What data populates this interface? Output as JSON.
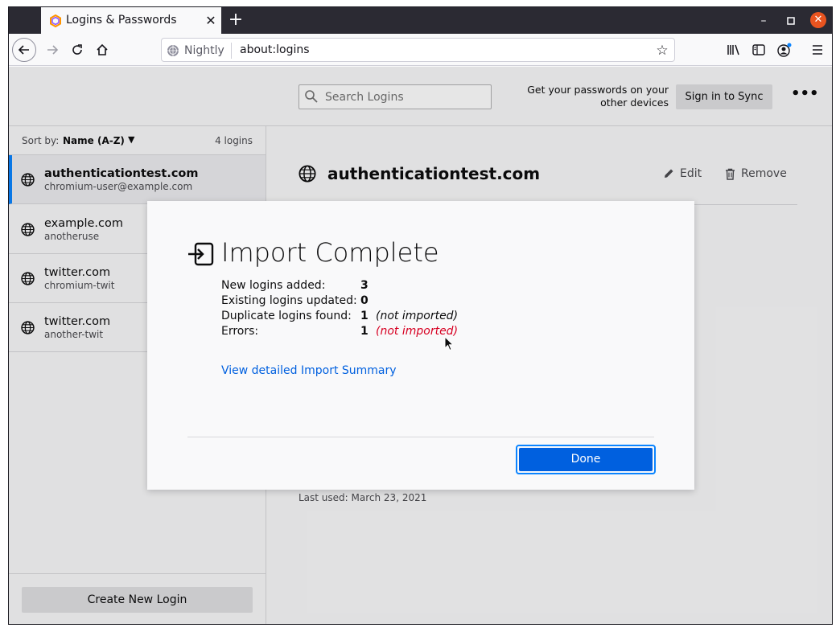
{
  "browser": {
    "tab_title": "Logins & Passwords",
    "identity_label": "Nightly",
    "url": "about:logins"
  },
  "header": {
    "search_placeholder": "Search Logins",
    "sync_text": "Get your passwords on your other devices",
    "sync_button": "Sign in to Sync"
  },
  "sidebar": {
    "sort_label": "Sort by:",
    "sort_value": "Name (A-Z)",
    "login_count": "4 logins",
    "items": [
      {
        "title": "authenticationtest.com",
        "subtitle": "chromium-user@example.com"
      },
      {
        "title": "example.com",
        "subtitle": "anotheruse"
      },
      {
        "title": "twitter.com",
        "subtitle": "chromium-twit"
      },
      {
        "title": "twitter.com",
        "subtitle": "another-twit"
      }
    ],
    "create_button": "Create New Login"
  },
  "detail": {
    "title": "authenticationtest.com",
    "edit_label": "Edit",
    "remove_label": "Remove",
    "last_used": "Last used: March 23, 2021"
  },
  "dialog": {
    "title": "Import Complete",
    "stats": [
      {
        "label": "New logins added:",
        "value": "3",
        "note": ""
      },
      {
        "label": "Existing logins updated:",
        "value": "0",
        "note": ""
      },
      {
        "label": "Duplicate logins found:",
        "value": "1",
        "note": "(not imported)"
      },
      {
        "label": "Errors:",
        "value": "1",
        "note": "(not imported)"
      }
    ],
    "summary_link": "View detailed Import Summary",
    "done_button": "Done"
  },
  "colors": {
    "accent": "#0060df",
    "error": "#d70022",
    "focus_ring": "#0a84ff",
    "selected_bar": "#0a84ff"
  }
}
